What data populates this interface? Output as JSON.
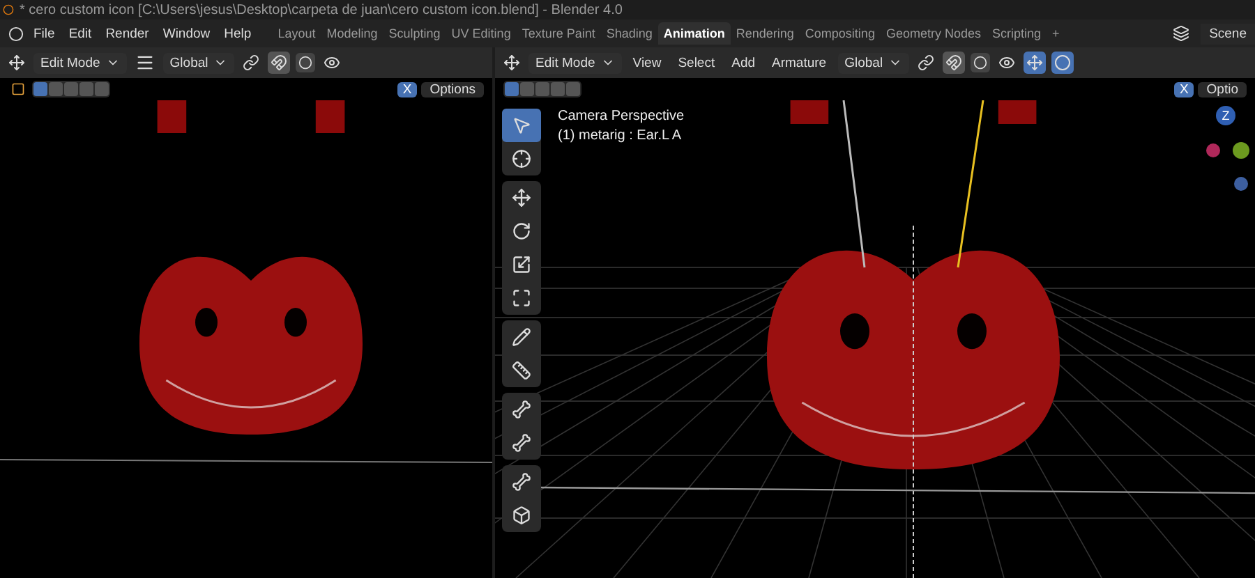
{
  "title_bar": {
    "title": "* cero custom icon [C:\\Users\\jesus\\Desktop\\carpeta de juan\\cero custom icon.blend] - Blender 4.0"
  },
  "menu": [
    "File",
    "Edit",
    "Render",
    "Window",
    "Help"
  ],
  "workspaces": [
    {
      "label": "Layout",
      "selected": false
    },
    {
      "label": "Modeling",
      "selected": false
    },
    {
      "label": "Sculpting",
      "selected": false
    },
    {
      "label": "UV Editing",
      "selected": false
    },
    {
      "label": "Texture Paint",
      "selected": false
    },
    {
      "label": "Shading",
      "selected": false
    },
    {
      "label": "Animation",
      "selected": true
    },
    {
      "label": "Rendering",
      "selected": false
    },
    {
      "label": "Compositing",
      "selected": false
    },
    {
      "label": "Geometry Nodes",
      "selected": false
    },
    {
      "label": "Scripting",
      "selected": false
    }
  ],
  "add_workspace": "+",
  "scene": "Scene",
  "left_view": {
    "mode": "Edit Mode",
    "orientation": "Global",
    "axis": "X",
    "options": "Options"
  },
  "right_view": {
    "mode": "Edit Mode",
    "menus": [
      "View",
      "Select",
      "Add",
      "Armature"
    ],
    "orientation": "Global",
    "axis": "X",
    "options": "Optio",
    "overlay": [
      "Camera Perspective",
      "(1) metarig : Ear.L A"
    ],
    "tool_groups": [
      [
        {
          "kind": "select",
          "selected": true
        },
        {
          "kind": "cursor",
          "selected": false
        }
      ],
      [
        {
          "kind": "move",
          "selected": false
        },
        {
          "kind": "rotate",
          "selected": false
        },
        {
          "kind": "scale",
          "selected": false
        },
        {
          "kind": "transform",
          "selected": false
        }
      ],
      [
        {
          "kind": "annotate",
          "selected": false
        },
        {
          "kind": "measure",
          "selected": false
        }
      ],
      [
        {
          "kind": "bone-size",
          "selected": false
        },
        {
          "kind": "envelope",
          "selected": false
        }
      ],
      [
        {
          "kind": "roll",
          "selected": false
        },
        {
          "kind": "extrude",
          "selected": false
        }
      ]
    ],
    "gizmo": {
      "z": "Z"
    }
  }
}
